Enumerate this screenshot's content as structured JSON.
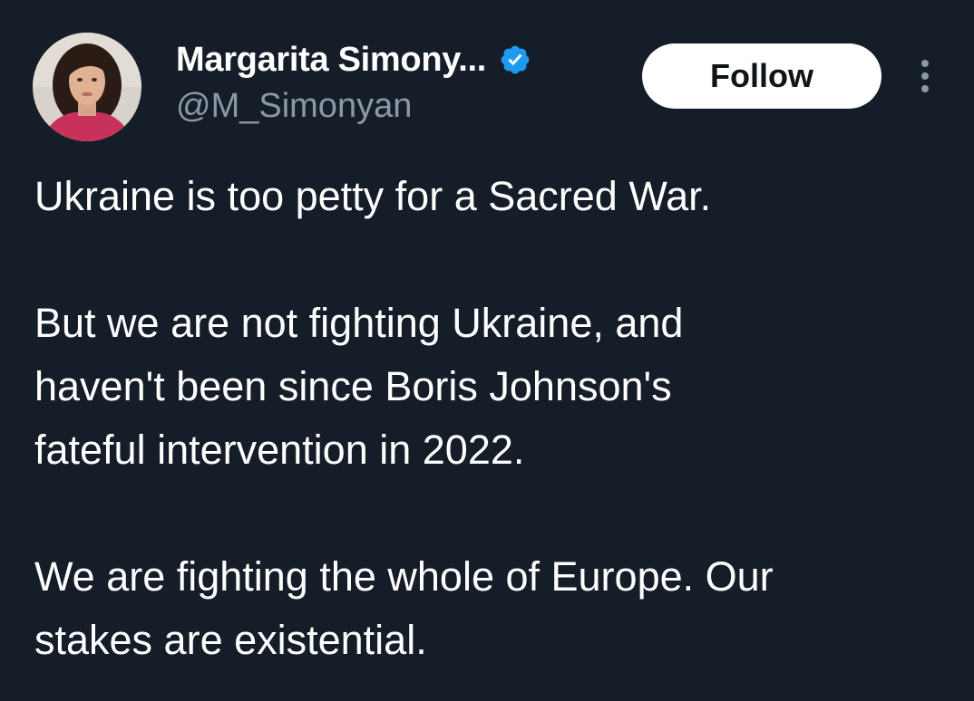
{
  "author": {
    "name": "Margarita Simony...",
    "handle": "@M_Simonyan",
    "verified_badge_icon": "verified-badge-icon",
    "verified_color": "#1d9bf0"
  },
  "actions": {
    "follow_label": "Follow",
    "more_icon": "more-vertical-icon"
  },
  "tweet": {
    "paragraphs": [
      "Ukraine is too petty for a Sacred War.",
      "But we are not fighting Ukraine, and\nhaven't been since Boris Johnson's\nfateful intervention in 2022.",
      "We are fighting the whole of Europe. Our\nstakes are existential."
    ]
  },
  "colors": {
    "background": "#151d28",
    "text_primary": "#ffffff",
    "text_secondary": "#8b98a5",
    "follow_bg": "#ffffff",
    "follow_text": "#0f1419"
  }
}
